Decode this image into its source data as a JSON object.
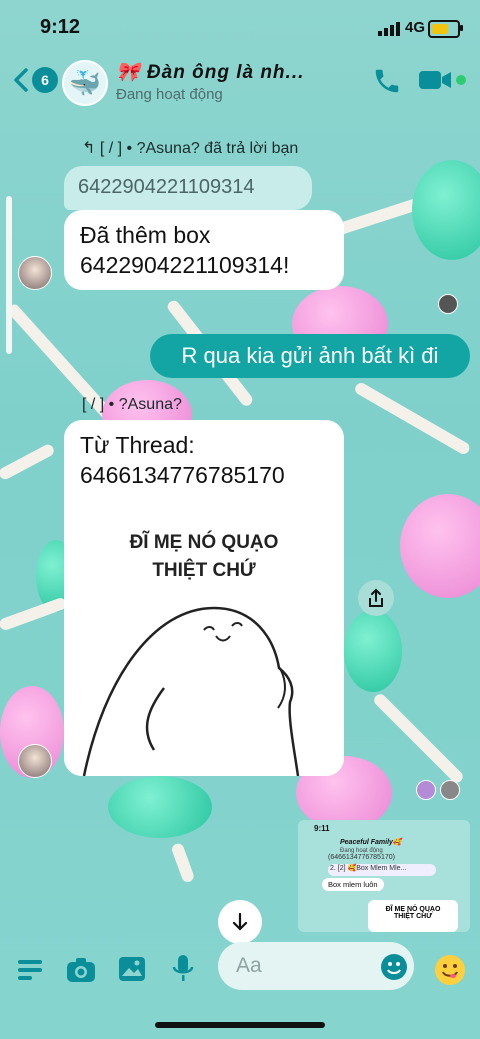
{
  "status_bar": {
    "time": "9:12",
    "network": "4G"
  },
  "header": {
    "back_count": "6",
    "title": "🎀 Đàn ông là nh...",
    "status": "Đang hoạt động"
  },
  "messages": {
    "reply_header": "↰ [ / ] • ?Asuna? đã trả lời bạn",
    "quoted": "6422904221109314",
    "bot_reply": "Đã thêm box 6422904221109314!",
    "my_message": "R qua kia gửi ảnh bất kì đi",
    "sender2": "[ / ] • ?Asuna?",
    "thread_text": "Từ Thread: 6466134776785170",
    "meme_line1": "ĐĨ MẸ NÓ QUẠO",
    "meme_line2": "THIỆT CHỨ"
  },
  "thumbnail": {
    "time": "9:11",
    "title": "Peaceful Family🥰",
    "subtitle": "Đang hoạt động",
    "row1": "(6466134776785170)",
    "row2": "2. [2] 🥰Box Mlem Mle...",
    "chip": "Box mlem luôn",
    "meme_line1": "ĐĨ MẸ NÓ QUẠO",
    "meme_line2": "THIỆT CHỨ"
  },
  "composer": {
    "placeholder": "Aa"
  },
  "colors": {
    "accent": "#0a8f9a",
    "my_bubble": "#12a5a4",
    "background": "#8ed5cf"
  }
}
